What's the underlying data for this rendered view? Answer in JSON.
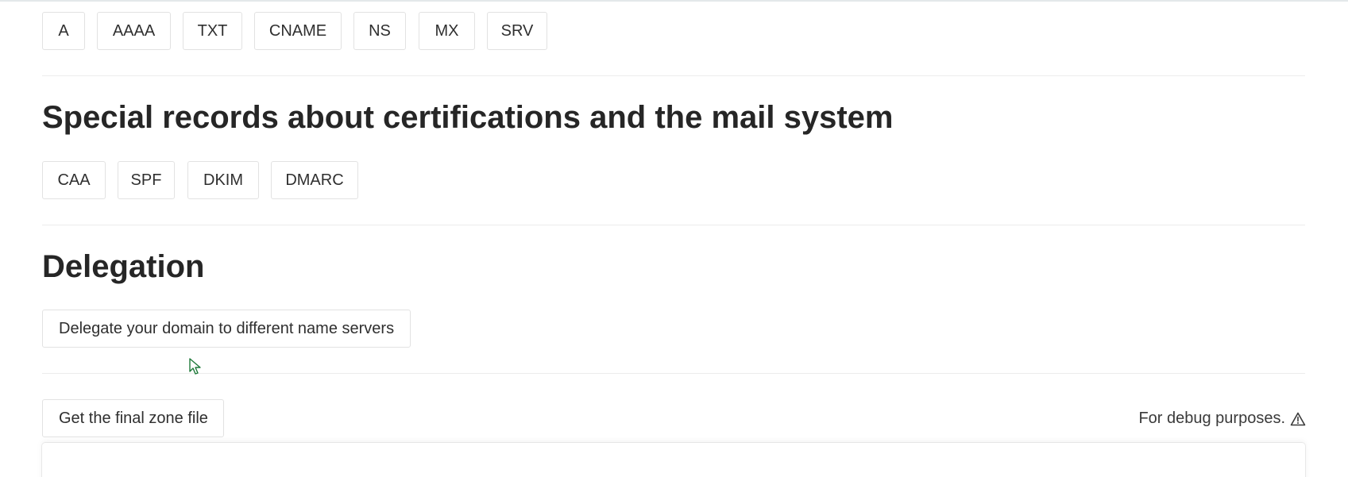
{
  "record_types": {
    "basic": [
      "A",
      "AAAA",
      "TXT",
      "CNAME",
      "NS",
      "MX",
      "SRV"
    ],
    "special": [
      "CAA",
      "SPF",
      "DKIM",
      "DMARC"
    ]
  },
  "sections": {
    "special_heading": "Special records about certifications and the mail system",
    "delegation_heading": "Delegation",
    "delegate_button": "Delegate your domain to different name servers"
  },
  "zone_file": {
    "button": "Get the final zone file",
    "debug_note": "For debug purposes."
  },
  "icons": {
    "warning": "warning-triangle-icon",
    "cursor": "mouse-pointer-icon"
  },
  "colors": {
    "border": "#e2e2e2",
    "divider": "#ececec",
    "text": "#2f2f2f",
    "cursor_fill": "#ffffff",
    "cursor_stroke": "#1f7a3a"
  }
}
